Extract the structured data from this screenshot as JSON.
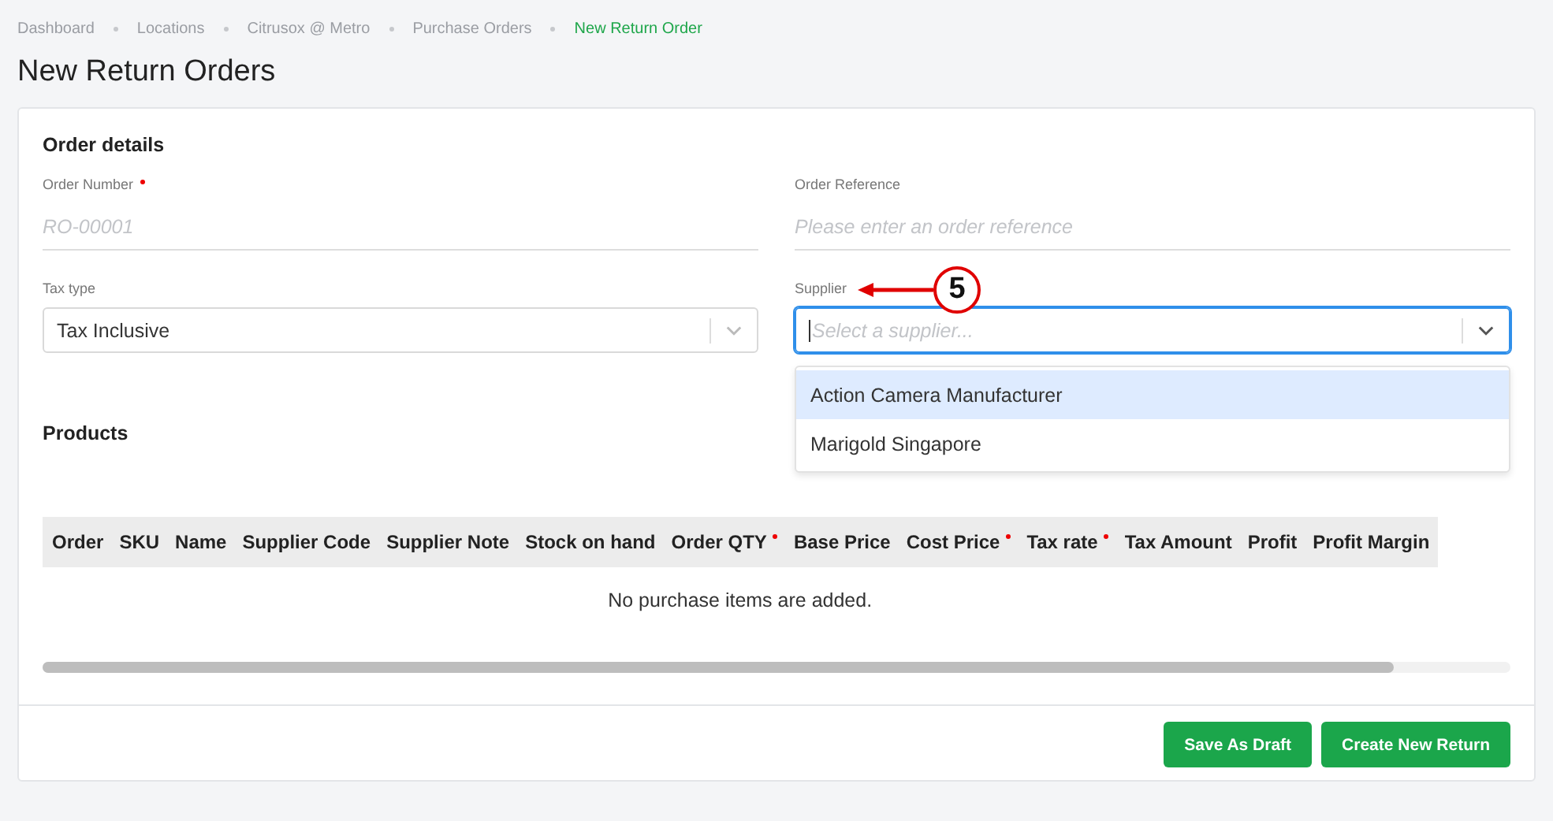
{
  "breadcrumb": [
    {
      "label": "Dashboard",
      "selected": false
    },
    {
      "label": "Locations",
      "selected": false
    },
    {
      "label": "Citrusox @ Metro",
      "selected": false
    },
    {
      "label": "Purchase Orders",
      "selected": false
    },
    {
      "label": "New Return Order",
      "selected": true
    }
  ],
  "title": "New Return Orders",
  "section_title": "Order details",
  "fields": [
    {
      "kind": "text",
      "label": "Order Number",
      "required": true,
      "placeholder": "RO-00001"
    },
    {
      "kind": "text",
      "label": "Order Reference",
      "required": false,
      "placeholder": "Please enter an order reference"
    },
    {
      "kind": "select",
      "label": "Tax type",
      "required": false,
      "value": "Tax Inclusive",
      "focused": false
    },
    {
      "kind": "select",
      "label": "Supplier",
      "required": false,
      "placeholder": "Select a supplier...",
      "focused": true,
      "options": [
        {
          "label": "Action Camera Manufacturer",
          "selected": true
        },
        {
          "label": "Marigold Singapore",
          "selected": false
        }
      ]
    }
  ],
  "callout": {
    "label": "5"
  },
  "products": {
    "title": "Products",
    "columns": [
      {
        "label": "Order",
        "required": false
      },
      {
        "label": "SKU",
        "required": false
      },
      {
        "label": "Name",
        "required": false
      },
      {
        "label": "Supplier Code",
        "required": false
      },
      {
        "label": "Supplier Note",
        "required": false
      },
      {
        "label": "Stock on hand",
        "required": false
      },
      {
        "label": "Order QTY",
        "required": true
      },
      {
        "label": "Base Price",
        "required": false
      },
      {
        "label": "Cost Price",
        "required": true
      },
      {
        "label": "Tax rate",
        "required": true
      },
      {
        "label": "Tax Amount",
        "required": false
      },
      {
        "label": "Profit",
        "required": false
      },
      {
        "label": "Profit Margin",
        "required": false
      }
    ],
    "empty_message": "No purchase items are added."
  },
  "buttons": [
    "Save As Draft",
    "Create New Return"
  ]
}
